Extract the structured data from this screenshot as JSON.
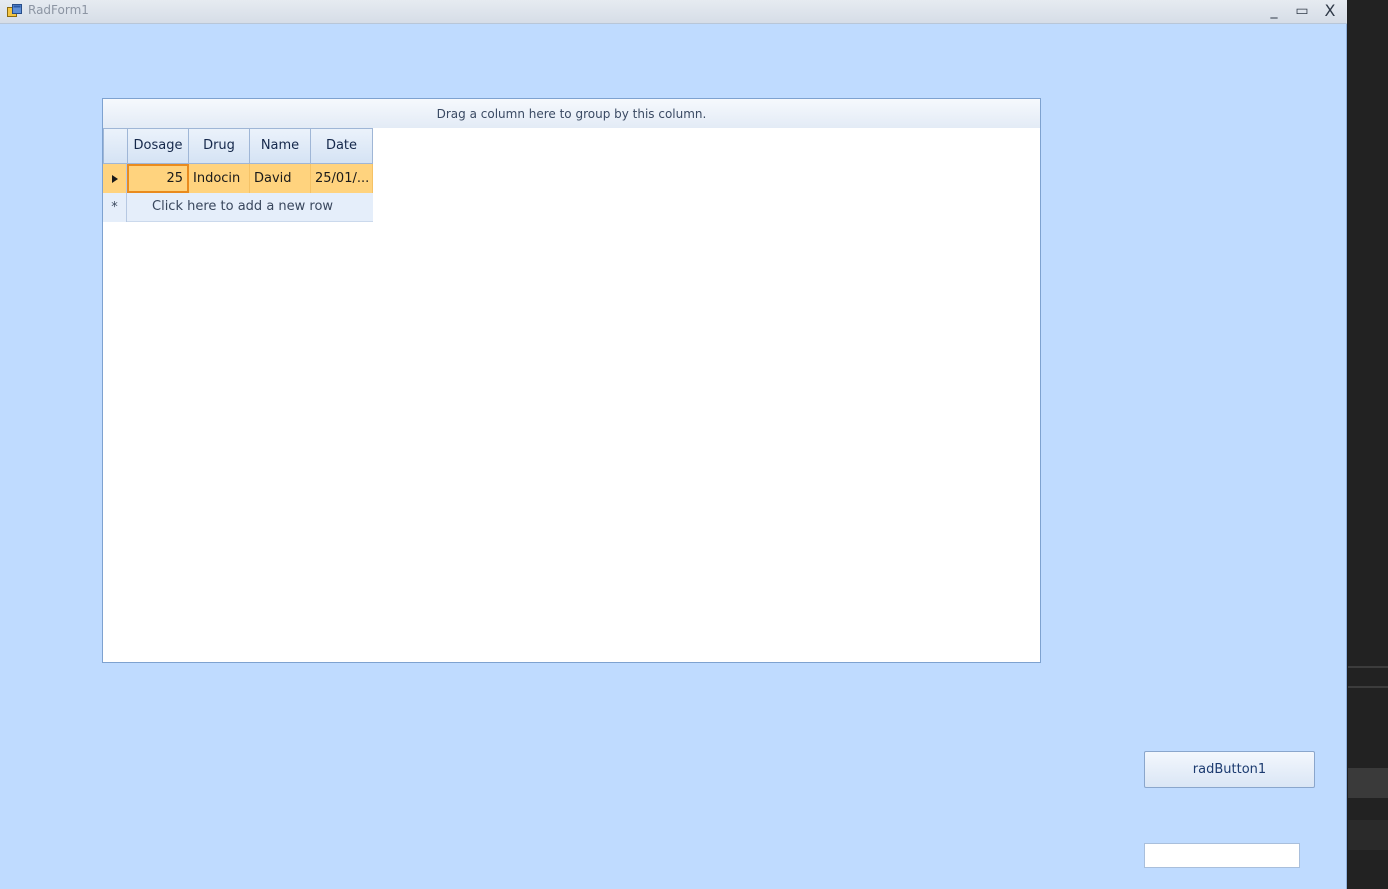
{
  "window": {
    "title": "RadForm1",
    "minimize_glyph": "_",
    "maximize_glyph": "▭",
    "close_glyph": "X",
    "icon": "winform-icon"
  },
  "grid": {
    "group_panel_text": "Drag a column here to group by this column.",
    "columns": [
      "Dosage",
      "Drug",
      "Name",
      "Date"
    ],
    "rows": [
      {
        "indicator": "current-row-arrow",
        "Dosage": "25",
        "Drug": "Indocin",
        "Name": "David",
        "Date": "25/01/..."
      }
    ],
    "new_row": {
      "indicator": "*",
      "text": "Click here to add a new row"
    }
  },
  "button": {
    "label": "radButton1"
  },
  "textbox": {
    "value": ""
  },
  "colors": {
    "form_background": "#bfdbff",
    "selected_row": "#ffd37e",
    "current_cell_border": "#e98b1e"
  }
}
